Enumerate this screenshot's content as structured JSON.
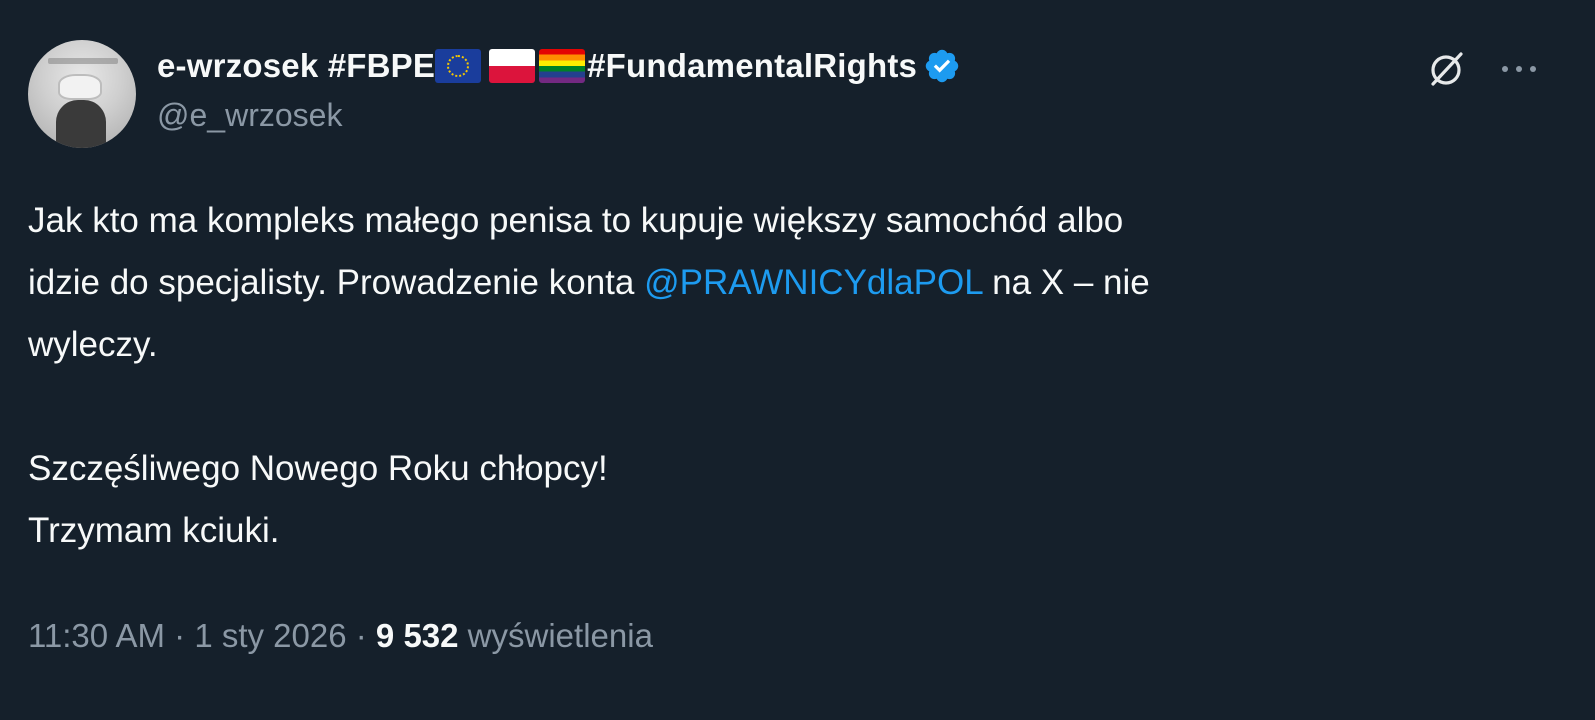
{
  "author": {
    "display_name": "e-wrzosek #FBPE",
    "display_name_suffix": "#FundamentalRights",
    "handle": "@e_wrzosek",
    "verified": true,
    "flags": [
      "eu-flag-icon",
      "poland-flag-icon",
      "rainbow-flag-icon"
    ]
  },
  "tweet": {
    "text_part1": "Jak kto ma kompleks małego penisa to kupuje większy samochód albo\nidzie do specjalisty. Prowadzenie konta ",
    "mention": "@PRAWNICYdlaPOL",
    "text_part2": " na X – nie\nwyleczy.\n\nSzczęśliwego Nowego Roku chłopcy!\nTrzymam kciuki."
  },
  "meta": {
    "time": "11:30 AM",
    "sep1": " · ",
    "date": "1 sty 2026",
    "sep2": " · ",
    "views_count": "9 532",
    "views_label": " wyświetlenia"
  },
  "colors": {
    "background": "#15202b",
    "text": "#f7f9f9",
    "secondary": "#8b98a5",
    "accent": "#1d9bf0"
  }
}
